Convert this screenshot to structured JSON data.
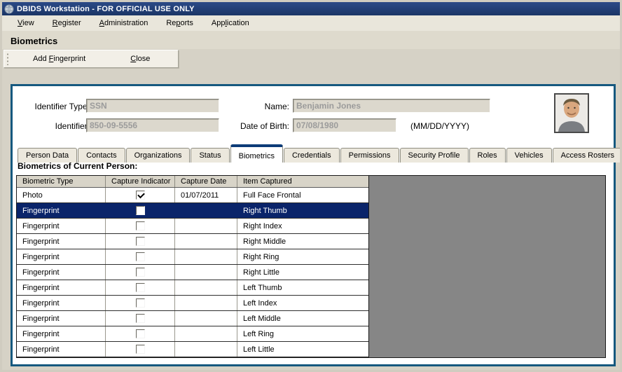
{
  "window": {
    "title": "DBIDS Workstation - FOR OFFICIAL USE ONLY"
  },
  "menu": {
    "items": [
      {
        "pre": "",
        "key": "V",
        "post": "iew"
      },
      {
        "pre": "",
        "key": "R",
        "post": "egister"
      },
      {
        "pre": "",
        "key": "A",
        "post": "dministration"
      },
      {
        "pre": "Re",
        "key": "p",
        "post": "orts"
      },
      {
        "pre": "App",
        "key": "l",
        "post": "ication"
      }
    ]
  },
  "page_heading": "Biometrics",
  "toolbar": {
    "add_fingerprint": {
      "pre": "Add ",
      "key": "F",
      "post": "ingerprint"
    },
    "close": {
      "pre": "",
      "key": "C",
      "post": "lose"
    }
  },
  "form": {
    "identifier_type": {
      "label": "Identifier Type:",
      "value": "SSN"
    },
    "identifier": {
      "label": "Identifier:",
      "value": "850-09-5556"
    },
    "name": {
      "label": "Name:",
      "value": "Benjamin Jones"
    },
    "dob": {
      "label": "Date of Birth:",
      "value": "07/08/1980",
      "format_hint": "(MM/DD/YYYY)"
    },
    "photo_icon": "person-portrait-photo"
  },
  "tabs": {
    "items": [
      {
        "label": "Person Data",
        "active": false
      },
      {
        "label": "Contacts",
        "active": false
      },
      {
        "label": "Organizations",
        "active": false
      },
      {
        "label": "Status",
        "active": false
      },
      {
        "label": "Biometrics",
        "active": true
      },
      {
        "label": "Credentials",
        "active": false
      },
      {
        "label": "Permissions",
        "active": false
      },
      {
        "label": "Security Profile",
        "active": false
      },
      {
        "label": "Roles",
        "active": false
      },
      {
        "label": "Vehicles",
        "active": false
      },
      {
        "label": "Access Rosters",
        "active": false
      }
    ]
  },
  "section_heading": "Biometrics of Current Person:",
  "table": {
    "columns": [
      "Biometric Type",
      "Capture Indicator",
      "Capture Date",
      "Item Captured"
    ],
    "rows": [
      {
        "type": "Photo",
        "captured": true,
        "date": "01/07/2011",
        "item": "Full Face Frontal",
        "selected": false
      },
      {
        "type": "Fingerprint",
        "captured": false,
        "date": "",
        "item": "Right Thumb",
        "selected": true
      },
      {
        "type": "Fingerprint",
        "captured": false,
        "date": "",
        "item": "Right Index",
        "selected": false
      },
      {
        "type": "Fingerprint",
        "captured": false,
        "date": "",
        "item": "Right Middle",
        "selected": false
      },
      {
        "type": "Fingerprint",
        "captured": false,
        "date": "",
        "item": "Right Ring",
        "selected": false
      },
      {
        "type": "Fingerprint",
        "captured": false,
        "date": "",
        "item": "Right Little",
        "selected": false
      },
      {
        "type": "Fingerprint",
        "captured": false,
        "date": "",
        "item": "Left Thumb",
        "selected": false
      },
      {
        "type": "Fingerprint",
        "captured": false,
        "date": "",
        "item": "Left Index",
        "selected": false
      },
      {
        "type": "Fingerprint",
        "captured": false,
        "date": "",
        "item": "Left Middle",
        "selected": false
      },
      {
        "type": "Fingerprint",
        "captured": false,
        "date": "",
        "item": "Left Ring",
        "selected": false
      },
      {
        "type": "Fingerprint",
        "captured": false,
        "date": "",
        "item": "Left Little",
        "selected": false
      }
    ]
  },
  "colors": {
    "titlebar": "#1e3d73",
    "selection": "#0a246a",
    "panel_border": "#16597f",
    "active_tab_accent": "#0d3c78",
    "grid_filler": "#868686",
    "window_bg": "#d6d2c6",
    "disabled_field_text": "#9b9b9b"
  }
}
